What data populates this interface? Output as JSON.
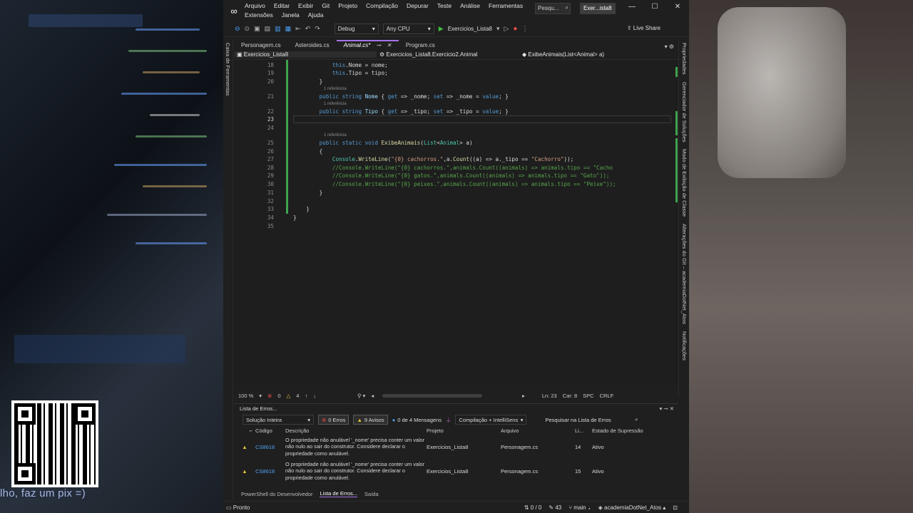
{
  "background": {
    "caption": "lho, faz um pix =)"
  },
  "window": {
    "menus": [
      "Arquivo",
      "Editar",
      "Exibir",
      "Git",
      "Projeto",
      "Compilação",
      "Depurar",
      "Teste",
      "Análise",
      "Ferramentas",
      "Extensões",
      "Janela",
      "Ajuda"
    ],
    "search_placeholder": "Pesqu...",
    "solution_badge": "Exer...ista8",
    "controls": [
      "—",
      "☐",
      "✕"
    ]
  },
  "toolbar": {
    "config": "Debug",
    "platform": "Any CPU",
    "run_target": "Exercicios_Lista8",
    "live_share": "Live Share"
  },
  "left_rail": [
    "Caixa de Ferramentas"
  ],
  "right_rail": [
    "Propriedades",
    "Gerenciador de Soluções",
    "Modo de Exibição de Classe",
    "Alterações do Git – academiaDotNet_Atos",
    "Notificações"
  ],
  "tabs": [
    {
      "label": "Personagem.cs",
      "active": false
    },
    {
      "label": "Asteroides.cs",
      "active": false
    },
    {
      "label": "Animal.cs*",
      "active": true
    },
    {
      "label": "Program.cs",
      "active": false
    }
  ],
  "navbar": {
    "project": "Exercicios_Lista8",
    "type": "Exercicios_Lista8.Exercicio2.Animal",
    "member": "ExibeAnimais(List<Animal> a)"
  },
  "code": {
    "reference_label": "1 referência",
    "line_numbers": [
      "18",
      "19",
      "20",
      "21",
      "22",
      "23",
      "24",
      "25",
      "26",
      "27",
      "28",
      "29",
      "30",
      "31",
      "32",
      "33",
      "34",
      "35"
    ],
    "current_line": "23"
  },
  "status": {
    "zoom": "100 %",
    "errors": "0",
    "warnings": "4",
    "position": "Ln: 23",
    "column": "Car: 8",
    "spacing": "SPC",
    "line_ending": "CRLF"
  },
  "error_list": {
    "title": "Lista de Erros...",
    "scope": "Solução Inteira",
    "errors_filter": "0 Erros",
    "warnings_filter": "9 Avisos",
    "messages_filter": "0 de 4 Mensagens",
    "build_filter": "Compilação + IntelliSens",
    "search_placeholder": "Pesquisar na Lista de Erros",
    "columns": [
      "Código",
      "Descrição",
      "Projeto",
      "Arquivo",
      "Li...",
      "Estado de Supressão"
    ],
    "rows": [
      {
        "code": "CS8618",
        "description": "O propriedade não anulável '_nome' precisa conter um valor não nulo ao sair do construtor. Considere declarar o propriedade como anulável.",
        "project": "Exercicios_Lista8",
        "file": "Personagem.cs",
        "line": "14",
        "state": "Ativo"
      },
      {
        "code": "CS8618",
        "description": "O propriedade não anulável '_nome' precisa conter um valor não nulo ao sair do construtor. Considere declarar o propriedade como anulável.",
        "project": "Exercicios_Lista8",
        "file": "Personagem.cs",
        "line": "15",
        "state": "Ativo"
      }
    ]
  },
  "bottom_tabs": [
    "PowerShell do Desenvolvedor",
    "Lista de Erros...",
    "Saída"
  ],
  "footer": {
    "status": "Pronto",
    "arrows": "0 / 0",
    "pencil_count": "43",
    "branch": "main",
    "repo": "academiaDotNet_Atos"
  }
}
